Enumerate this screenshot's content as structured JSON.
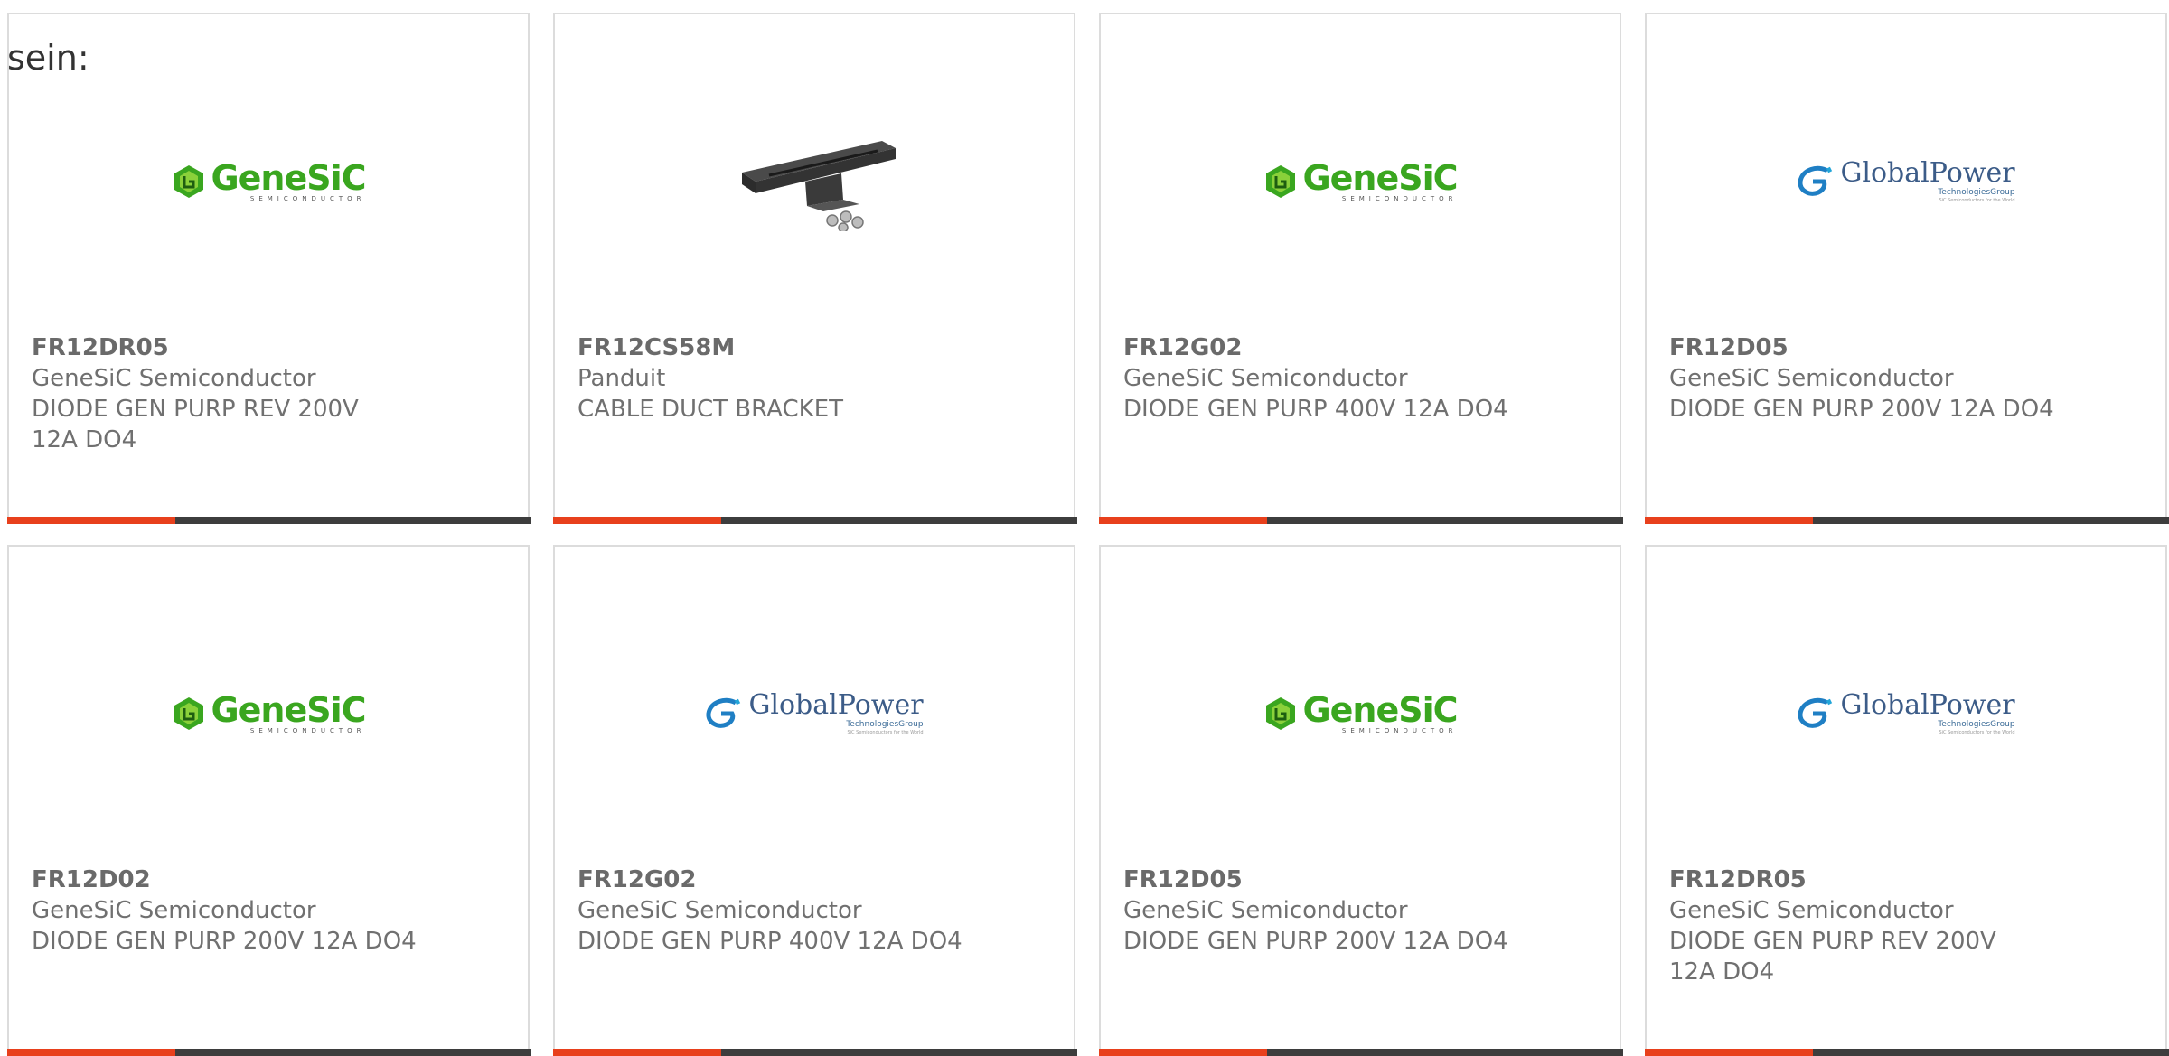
{
  "intro_text": "sein:",
  "colors": {
    "accent": "#e8401c",
    "bar": "#3d3d3d",
    "genesic_green": "#3aa61f",
    "globalpower_blue": "#3c5c88"
  },
  "logos": {
    "genesic": {
      "word": "GeneSiC",
      "sub": "SEMICONDUCTOR"
    },
    "globalpower": {
      "word": "GlobalPower",
      "tag": "TechnologiesGroup",
      "tag2": "SiC Semiconductors for the World"
    }
  },
  "cards": [
    {
      "part_number": "FR12DR05",
      "manufacturer": "GeneSiC Semiconductor",
      "description": "DIODE GEN PURP REV 200V 12A DO4",
      "image": "genesic-logo",
      "progress": 0.32
    },
    {
      "part_number": "FR12CS58M",
      "manufacturer": "Panduit",
      "description": "CABLE DUCT BRACKET",
      "image": "cable-duct-bracket-photo",
      "progress": 0.32
    },
    {
      "part_number": "FR12G02",
      "manufacturer": "GeneSiC Semiconductor",
      "description": "DIODE GEN PURP 400V 12A DO4",
      "image": "genesic-logo",
      "progress": 0.32
    },
    {
      "part_number": "FR12D05",
      "manufacturer": "GeneSiC Semiconductor",
      "description": "DIODE GEN PURP 200V 12A DO4",
      "image": "globalpower-logo",
      "progress": 0.32
    },
    {
      "part_number": "FR12D02",
      "manufacturer": "GeneSiC Semiconductor",
      "description": "DIODE GEN PURP 200V 12A DO4",
      "image": "genesic-logo",
      "progress": 0.32
    },
    {
      "part_number": "FR12G02",
      "manufacturer": "GeneSiC Semiconductor",
      "description": "DIODE GEN PURP 400V 12A DO4",
      "image": "globalpower-logo",
      "progress": 0.32
    },
    {
      "part_number": "FR12D05",
      "manufacturer": "GeneSiC Semiconductor",
      "description": "DIODE GEN PURP 200V 12A DO4",
      "image": "genesic-logo",
      "progress": 0.32
    },
    {
      "part_number": "FR12DR05",
      "manufacturer": "GeneSiC Semiconductor",
      "description": "DIODE GEN PURP REV 200V 12A DO4",
      "image": "globalpower-logo",
      "progress": 0.32
    }
  ]
}
